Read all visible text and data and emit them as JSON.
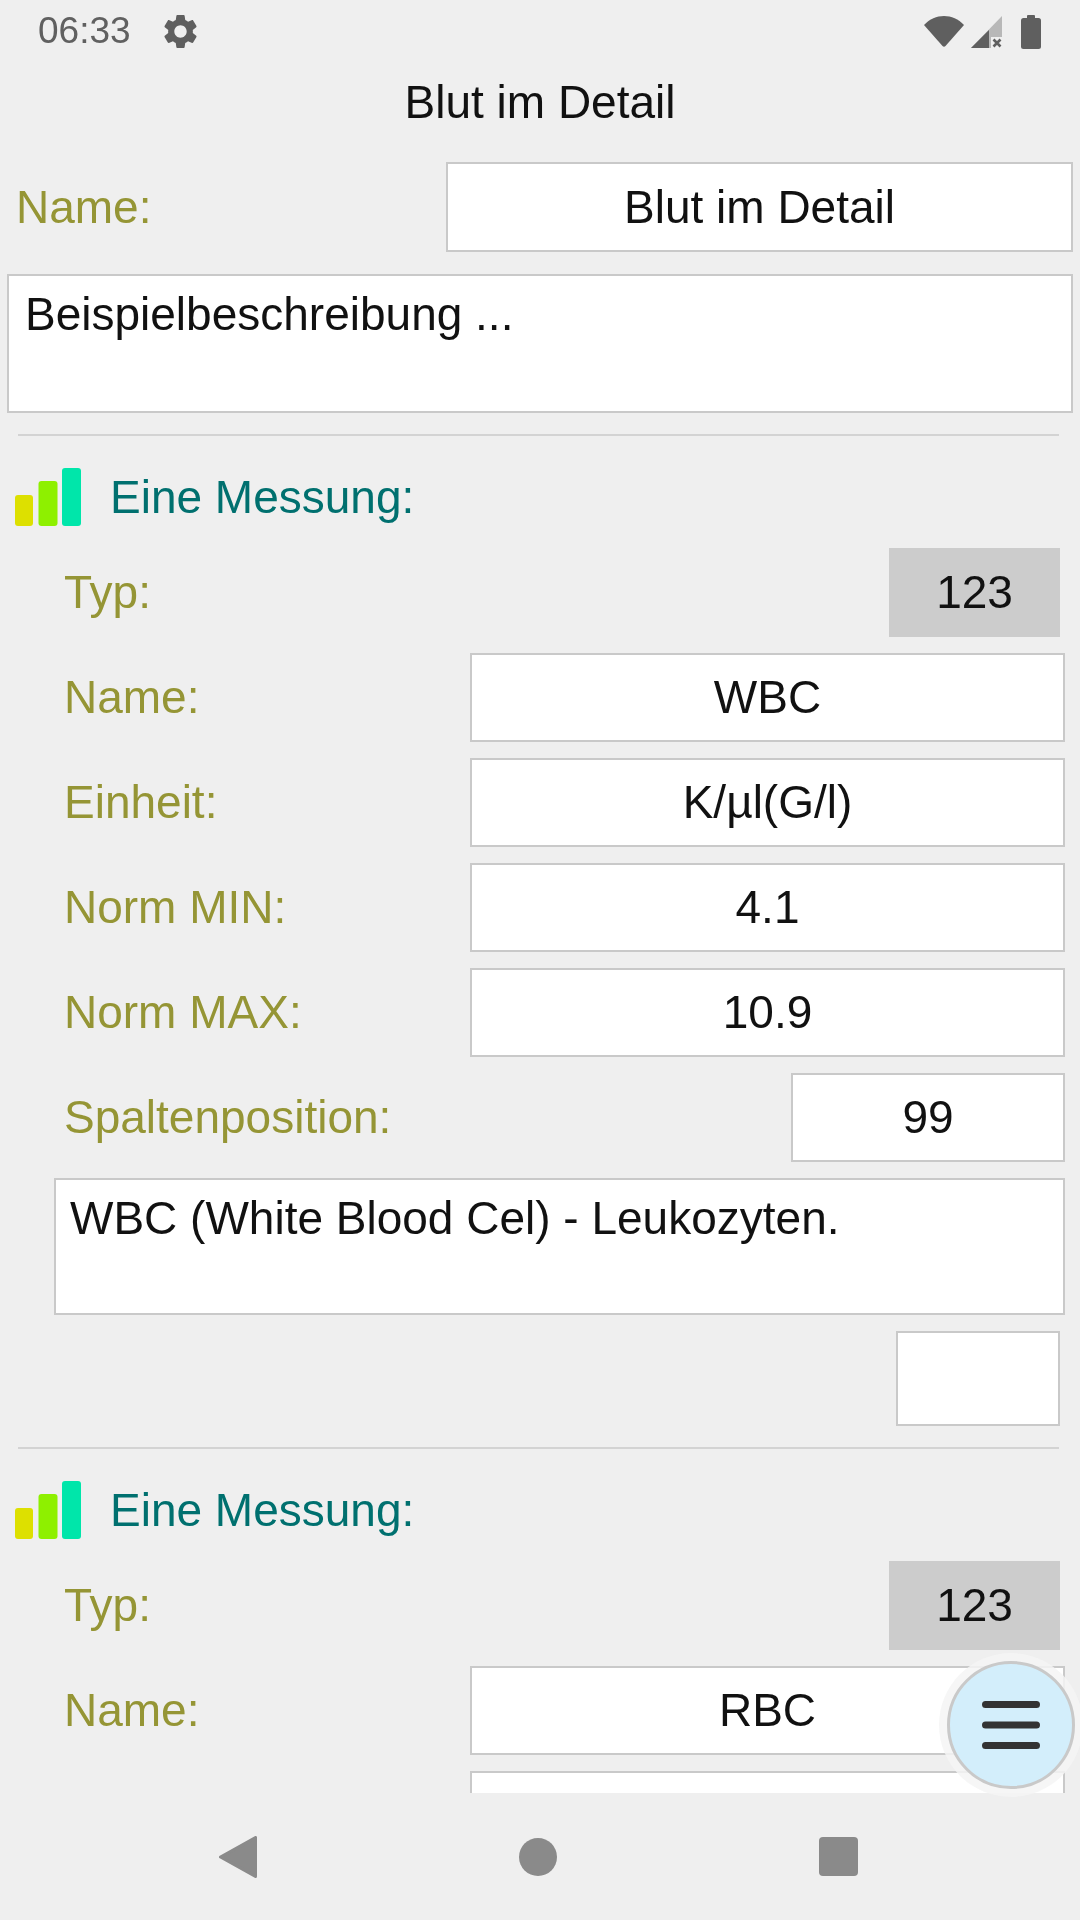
{
  "status_bar": {
    "time": "06:33"
  },
  "title": "Blut im Detail",
  "name": {
    "label": "Name:",
    "value": "Blut im Detail"
  },
  "description": "Beispielbeschreibung ...",
  "measurements": [
    {
      "title": "Eine Messung:",
      "rows": [
        {
          "kind": "type",
          "label": "Typ:",
          "value": "123"
        },
        {
          "kind": "input",
          "label": "Name:",
          "value": "WBC"
        },
        {
          "kind": "input",
          "label": "Einheit:",
          "value": "K/µl(G/l)"
        },
        {
          "kind": "input",
          "label": "Norm MIN:",
          "value": "4.1"
        },
        {
          "kind": "input",
          "label": "Norm MAX:",
          "value": "10.9"
        },
        {
          "kind": "short",
          "label": "Spaltenposition:",
          "value": "99"
        },
        {
          "kind": "note",
          "value": "WBC (White Blood Cel) - Leukozyten."
        },
        {
          "kind": "blank"
        }
      ]
    },
    {
      "title": "Eine Messung:",
      "rows": [
        {
          "kind": "type",
          "label": "Typ:",
          "value": "123"
        },
        {
          "kind": "input",
          "label": "Name:",
          "value": "RBC"
        },
        {
          "kind": "input"
        }
      ]
    }
  ]
}
